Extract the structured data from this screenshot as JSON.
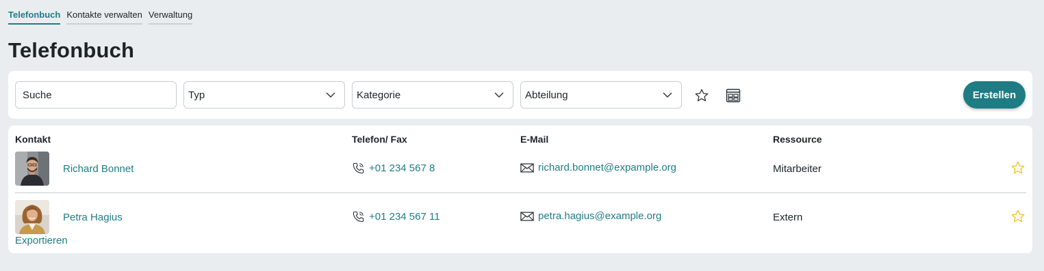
{
  "tabs": [
    {
      "label": "Telefonbuch",
      "active": true
    },
    {
      "label": "Kontakte verwalten",
      "active": false
    },
    {
      "label": "Verwaltung",
      "active": false
    }
  ],
  "page": {
    "title": "Telefonbuch"
  },
  "filters": {
    "search_placeholder": "Suche",
    "type_label": "Typ",
    "category_label": "Kategorie",
    "department_label": "Abteilung",
    "favorites_icon": "star-outline-icon",
    "layout_icon": "grid-layout-icon",
    "create_label": "Erstellen"
  },
  "table": {
    "headers": {
      "contact": "Kontakt",
      "phone": "Telefon/ Fax",
      "email": "E-Mail",
      "resource": "Ressource"
    },
    "rows": [
      {
        "name": "Richard Bonnet",
        "phone": "+01 234 567 8",
        "email": "richard.bonnet@expample.org",
        "resource": "Mitarbeiter"
      },
      {
        "name": "Petra Hagius",
        "phone": "+01 234 567 11",
        "email": "petra.hagius@example.org",
        "resource": "Extern"
      }
    ],
    "export_label": "Exportieren"
  },
  "colors": {
    "accent": "#1e7c84",
    "background": "#e9edef",
    "star": "#f2c230"
  }
}
